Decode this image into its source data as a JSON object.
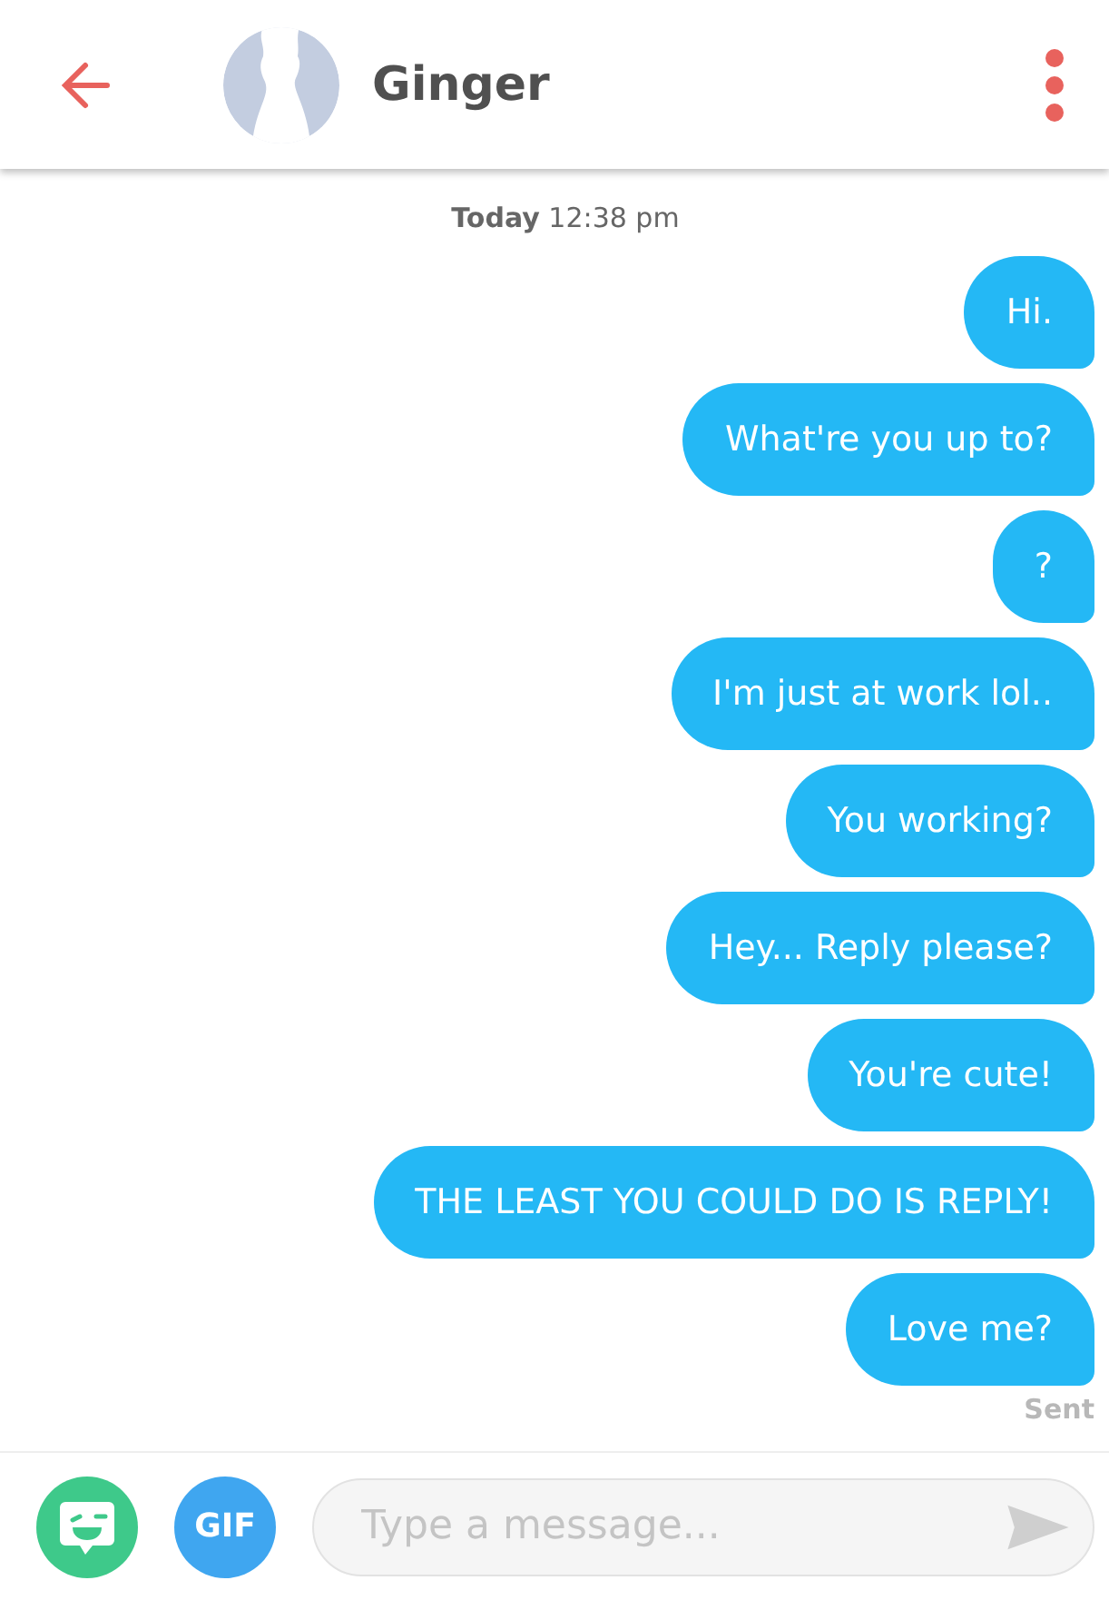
{
  "header": {
    "name": "Ginger"
  },
  "timestamp": "**Today** 12:38 pm",
  "messages": [
    {
      "text": "Hi."
    },
    {
      "text": "What're you up to?"
    },
    {
      "text": "?"
    },
    {
      "text": "I'm just at work lol.."
    },
    {
      "text": "You working?"
    },
    {
      "text": "Hey... Reply please?"
    },
    {
      "text": "You're cute!"
    },
    {
      "text": "THE LEAST YOU COULD DO IS REPLY!"
    },
    {
      "text": "Love me?"
    }
  ],
  "status": "Sent",
  "composer": {
    "gif_label": "GIF",
    "placeholder": "Type a message..."
  }
}
